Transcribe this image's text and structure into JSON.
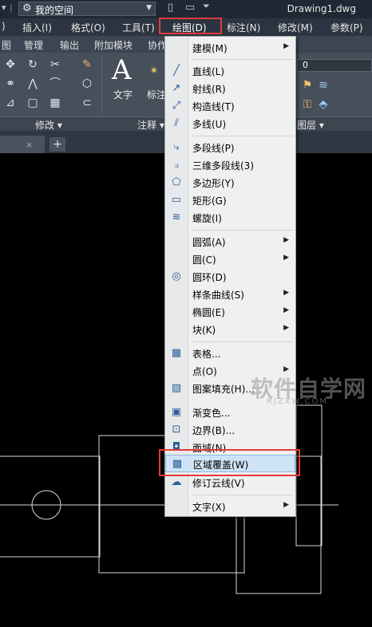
{
  "titlebar": {
    "workspace": "我的空间",
    "document": "Drawing1.dwg"
  },
  "menubar": {
    "items": [
      {
        "label": ")"
      },
      {
        "label": "插入(I)"
      },
      {
        "label": "格式(O)"
      },
      {
        "label": "工具(T)"
      },
      {
        "label": "绘图(D)"
      },
      {
        "label": "标注(N)"
      },
      {
        "label": "修改(M)"
      },
      {
        "label": "参数(P)"
      }
    ]
  },
  "ribbon_tabs": [
    "图",
    "管理",
    "输出",
    "附加模块",
    "协作"
  ],
  "ribbon": {
    "modify_label": "修改 ▾",
    "annotation_label": "注释 ▾",
    "layers_label": "图层 ▾",
    "text_label": "文字",
    "dim_label": "标注",
    "layer_value": "0"
  },
  "tabstrip": {
    "close": "×",
    "add": "+"
  },
  "dropdown": {
    "items": [
      {
        "label": "建模(M)",
        "submenu": true,
        "icon": ""
      },
      {
        "label": "直线(L)",
        "icon": "line-icon"
      },
      {
        "label": "射线(R)",
        "icon": "ray-icon"
      },
      {
        "label": "构造线(T)",
        "icon": "xline-icon"
      },
      {
        "label": "多线(U)",
        "icon": "mline-icon"
      },
      {
        "label": "多段线(P)",
        "icon": "polyline-icon"
      },
      {
        "label": "三维多段线(3)",
        "icon": "3dpoly-icon"
      },
      {
        "label": "多边形(Y)",
        "icon": "polygon-icon"
      },
      {
        "label": "矩形(G)",
        "icon": "rectangle-icon"
      },
      {
        "label": "螺旋(I)",
        "icon": "helix-icon"
      },
      {
        "label": "圆弧(A)",
        "submenu": true
      },
      {
        "label": "圆(C)",
        "submenu": true
      },
      {
        "label": "圆环(D)",
        "icon": "donut-icon"
      },
      {
        "label": "样条曲线(S)",
        "submenu": true
      },
      {
        "label": "椭圆(E)",
        "submenu": true
      },
      {
        "label": "块(K)",
        "submenu": true
      },
      {
        "label": "表格...",
        "icon": "table-icon"
      },
      {
        "label": "点(O)",
        "submenu": true
      },
      {
        "label": "图案填充(H)...",
        "icon": "hatch-icon"
      },
      {
        "label": "渐变色...",
        "icon": "gradient-icon"
      },
      {
        "label": "边界(B)...",
        "icon": "boundary-icon"
      },
      {
        "label": "面域(N)",
        "icon": "region-icon"
      },
      {
        "label": "区域覆盖(W)",
        "icon": "wipeout-icon",
        "highlighted": true
      },
      {
        "label": "修订云线(V)",
        "icon": "revcloud-icon"
      },
      {
        "label": "文字(X)",
        "submenu": true
      }
    ]
  },
  "watermark": {
    "text": "软件自学网",
    "url": "RJZXW.COM"
  }
}
